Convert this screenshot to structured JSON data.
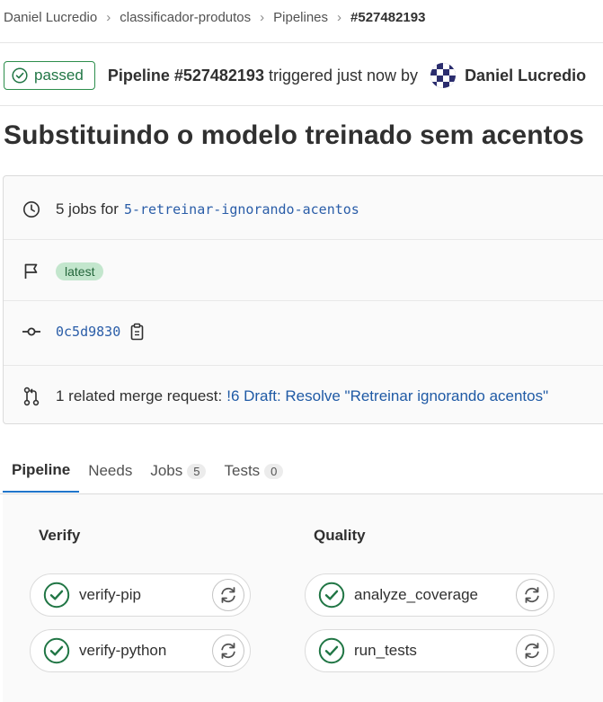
{
  "breadcrumb": {
    "items": [
      "Daniel Lucredio",
      "classificador-produtos",
      "Pipelines"
    ],
    "current": "#527482193",
    "separator": "›"
  },
  "header": {
    "status": "passed",
    "pipeline_label": "Pipeline #527482193",
    "triggered_text": "triggered just now by",
    "author": "Daniel Lucredio"
  },
  "title": "Substituindo o modelo treinado sem acentos",
  "info": {
    "jobs_text": "5 jobs for",
    "branch": "5-retreinar-ignorando-acentos",
    "latest_badge": "latest",
    "commit_sha": "0c5d9830",
    "mr_text": "1 related merge request:",
    "mr_link": "!6 Draft: Resolve \"Retreinar ignorando acentos\""
  },
  "tabs": [
    {
      "label": "Pipeline",
      "count": null,
      "active": true
    },
    {
      "label": "Needs",
      "count": null,
      "active": false
    },
    {
      "label": "Jobs",
      "count": "5",
      "active": false
    },
    {
      "label": "Tests",
      "count": "0",
      "active": false
    }
  ],
  "stages": [
    {
      "name": "Verify",
      "jobs": [
        "verify-pip",
        "verify-python"
      ]
    },
    {
      "name": "Quality",
      "jobs": [
        "analyze_coverage",
        "run_tests"
      ]
    }
  ],
  "colors": {
    "success": "#217645",
    "link": "#1f5aa5",
    "tab_underline": "#1f75cb"
  },
  "icons": {
    "status": "check-circle-icon",
    "jobs": "clock-icon",
    "latest": "flag-icon",
    "commit": "commit-icon",
    "copy": "clipboard-icon",
    "merge_request": "merge-request-icon",
    "retry": "retry-icon"
  }
}
